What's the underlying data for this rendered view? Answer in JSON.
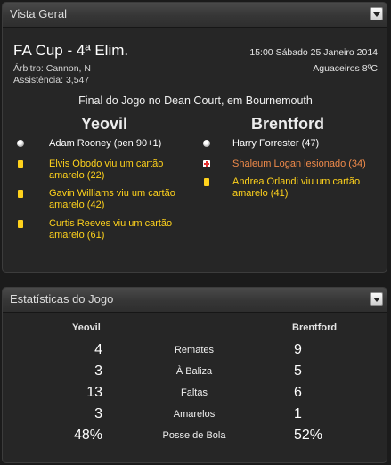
{
  "overview": {
    "title": "Vista Geral",
    "competition": "FA Cup - 4ª Elim.",
    "referee": "Árbitro: Cannon, N",
    "attendance": "Assistência: 3,547",
    "kickoff": "15:00 Sábado 25 Janeiro 2014",
    "weather": "Aguaceiros 8ºC",
    "venue": "Final do Jogo no Dean Court, em Bournemouth",
    "home_team": "Yeovil",
    "away_team": "Brentford",
    "home_events": [
      {
        "icon": "goal-ball-icon",
        "text": "Adam Rooney (pen 90+1)",
        "color": "#ffffff"
      },
      {
        "icon": "yellow-card-icon",
        "text": "Elvis Obodo viu um cartão amarelo (22)",
        "color": "#ffd21c"
      },
      {
        "icon": "yellow-card-icon",
        "text": "Gavin Williams viu um cartão amarelo (42)",
        "color": "#ffd21c"
      },
      {
        "icon": "yellow-card-icon",
        "text": "Curtis Reeves viu um cartão amarelo (61)",
        "color": "#ffd21c"
      }
    ],
    "away_events": [
      {
        "icon": "goal-ball-icon",
        "text": "Harry Forrester (47)",
        "color": "#ffffff"
      },
      {
        "icon": "injury-cross-icon",
        "text": "Shaleum Logan lesionado (34)",
        "color": "#ef8a4a"
      },
      {
        "icon": "yellow-card-icon",
        "text": "Andrea Orlandi viu um cartão amarelo (41)",
        "color": "#ffd21c"
      }
    ]
  },
  "stats": {
    "title": "Estatísticas do Jogo",
    "home_team": "Yeovil",
    "away_team": "Brentford",
    "rows": [
      {
        "label": "Remates",
        "home": "4",
        "away": "9"
      },
      {
        "label": "À Baliza",
        "home": "3",
        "away": "5"
      },
      {
        "label": "Faltas",
        "home": "13",
        "away": "6"
      },
      {
        "label": "Amarelos",
        "home": "3",
        "away": "1"
      },
      {
        "label": "Posse de Bola",
        "home": "48%",
        "away": "52%"
      }
    ]
  },
  "colors": {
    "panel_bg": "#262626",
    "page_bg": "#1b1b1b",
    "yellow_card": "#ffd21c",
    "injury_text": "#ef8a4a"
  }
}
